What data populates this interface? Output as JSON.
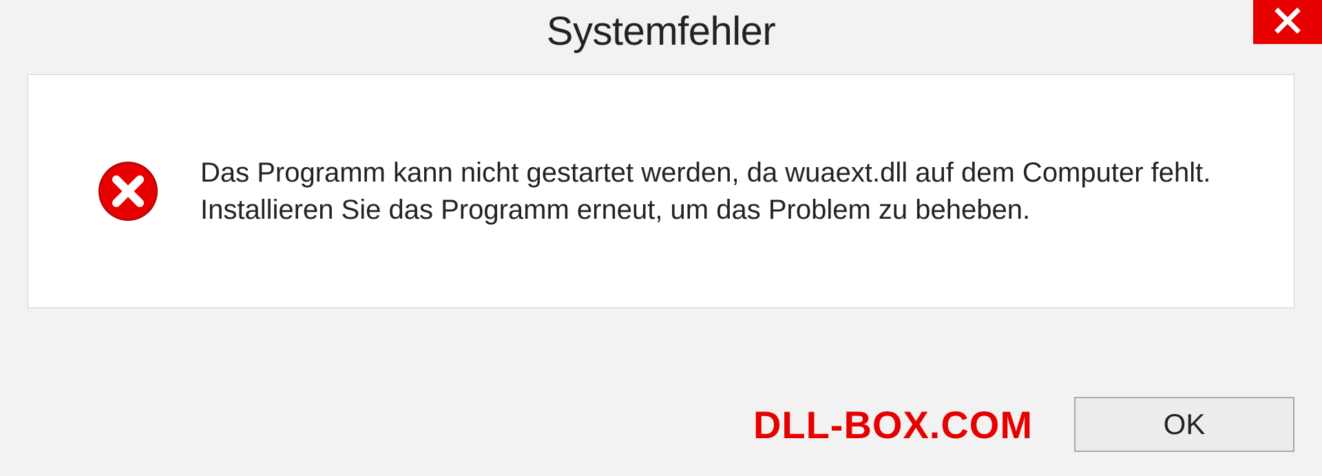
{
  "dialog": {
    "title": "Systemfehler",
    "message": "Das Programm kann nicht gestartet werden, da wuaext.dll auf dem Computer fehlt. Installieren Sie das Programm erneut, um das Problem zu beheben.",
    "ok_label": "OK"
  },
  "watermark": {
    "text": "DLL-BOX.COM"
  },
  "colors": {
    "accent_red": "#e60000",
    "panel_bg": "#ffffff",
    "body_bg": "#f2f2f2"
  }
}
